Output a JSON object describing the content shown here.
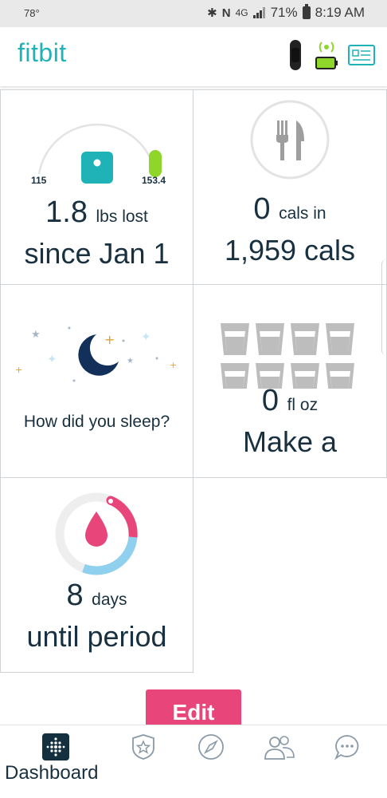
{
  "status_bar": {
    "temperature": "78°",
    "network": "4G",
    "battery_percent": "71%",
    "time": "8:19 AM"
  },
  "app": {
    "logo": "fitbit"
  },
  "tiles": {
    "weight": {
      "range_min": "115",
      "range_max": "153.4",
      "value": "1.8",
      "unit": "lbs lost",
      "subtitle": "since Jan 1"
    },
    "food": {
      "value": "0",
      "unit": "cals in",
      "subtitle": "1,959 cals"
    },
    "sleep": {
      "prompt": "How did you sleep?"
    },
    "water": {
      "value": "0",
      "unit": "fl oz",
      "subtitle": "Make a",
      "glasses_total": 8
    },
    "period": {
      "value": "8",
      "unit": "days",
      "subtitle": "until period"
    }
  },
  "edit_button": {
    "label": "Edit"
  },
  "bottom_nav": {
    "items": [
      {
        "icon": "dashboard-icon",
        "label": "Dashboard",
        "active": true
      },
      {
        "icon": "challenges-star-icon",
        "label": ""
      },
      {
        "icon": "discover-compass-icon",
        "label": ""
      },
      {
        "icon": "community-friends-icon",
        "label": ""
      },
      {
        "icon": "messages-chat-icon",
        "label": ""
      }
    ]
  },
  "colors": {
    "brand_teal": "#1fb3b8",
    "accent_pink": "#e8457a",
    "tracker_green": "#8fd62a",
    "sleep_navy": "#12305a",
    "period_blue": "#8fd0ee",
    "text_dark": "#18303f"
  }
}
